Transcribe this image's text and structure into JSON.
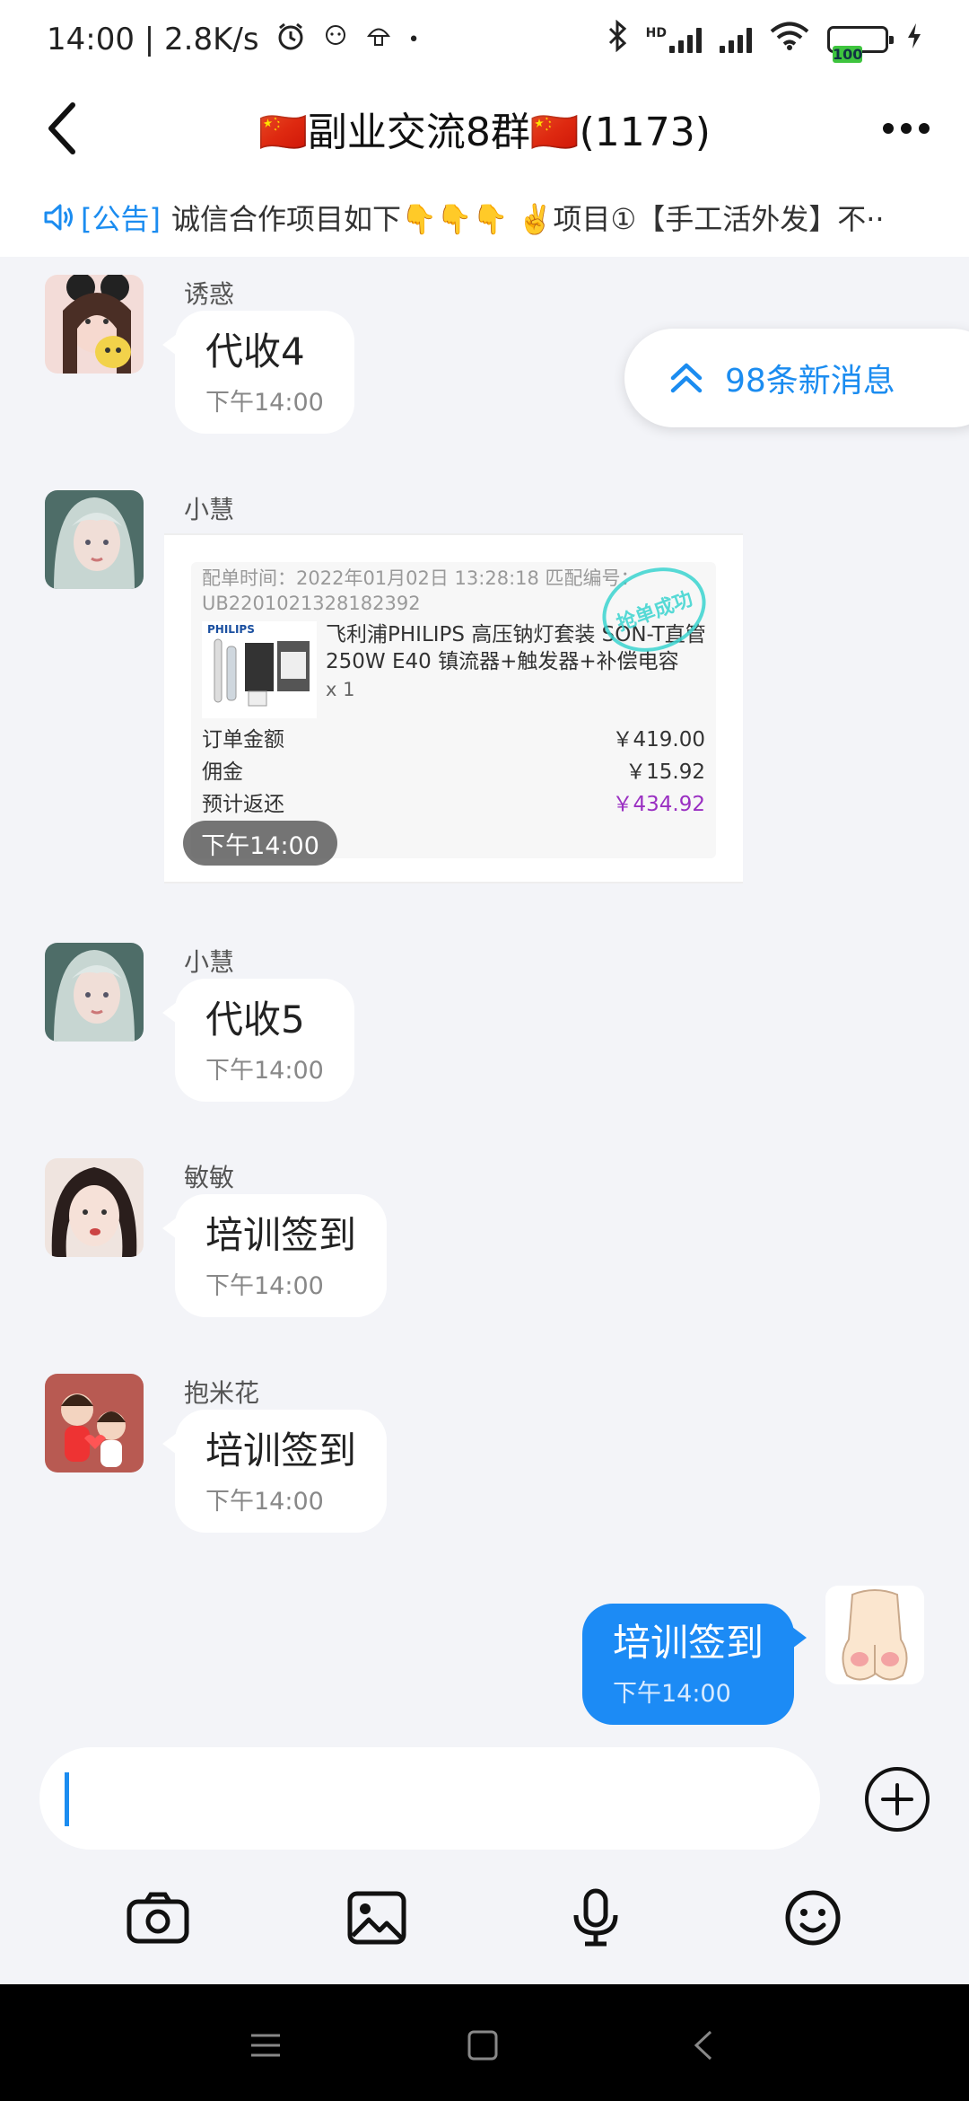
{
  "status_bar": {
    "time_speed": "14:00 | 2.8K/s",
    "dot": "•",
    "hd": "HD",
    "battery": "100"
  },
  "header": {
    "title": "🇨🇳副业交流8群🇨🇳(1173)"
  },
  "notice": {
    "tag": "[公告]",
    "text": "诚信合作项目如下👇👇👇 ✌️项目①【手工活外发】不··"
  },
  "new_messages": {
    "label": "98条新消息"
  },
  "messages": [
    {
      "sender": "诱惑",
      "text": "代收4",
      "time": "下午14:00",
      "avatar_color": "#e9c7c6"
    },
    {
      "sender": "小慧",
      "type": "order_card",
      "time": "下午14:00",
      "avatar_color": "#6f8e88",
      "card": {
        "meta": "配单时间：2022年01月02日 13:28:18 匹配编号：UB2201021328182392",
        "stamp": "抢单成功",
        "product_brand": "PHILIPS",
        "product_title": "飞利浦PHILIPS 高压钠灯套装 SON-T直管 250W E40 镇流器+触发器+补偿电容",
        "qty": "x 1",
        "rows": [
          {
            "label": "订单金额",
            "value": "￥419.00"
          },
          {
            "label": "佣金",
            "value": "￥15.92"
          },
          {
            "label": "预计返还",
            "value": "￥434.92"
          }
        ]
      }
    },
    {
      "sender": "小慧",
      "text": "代收5",
      "time": "下午14:00",
      "avatar_color": "#6f8e88"
    },
    {
      "sender": "敏敏",
      "text": "培训签到",
      "time": "下午14:00",
      "avatar_color": "#c9a49c"
    },
    {
      "sender": "抱米花",
      "text": "培训签到",
      "time": "下午14:00",
      "avatar_color": "#b85a52"
    }
  ],
  "my_message": {
    "text": "培训签到",
    "time": "下午14:00"
  },
  "colors": {
    "accent": "#1b8cf0",
    "my_bubble": "#1c8bf5",
    "price_purple": "#9a2fc2"
  }
}
